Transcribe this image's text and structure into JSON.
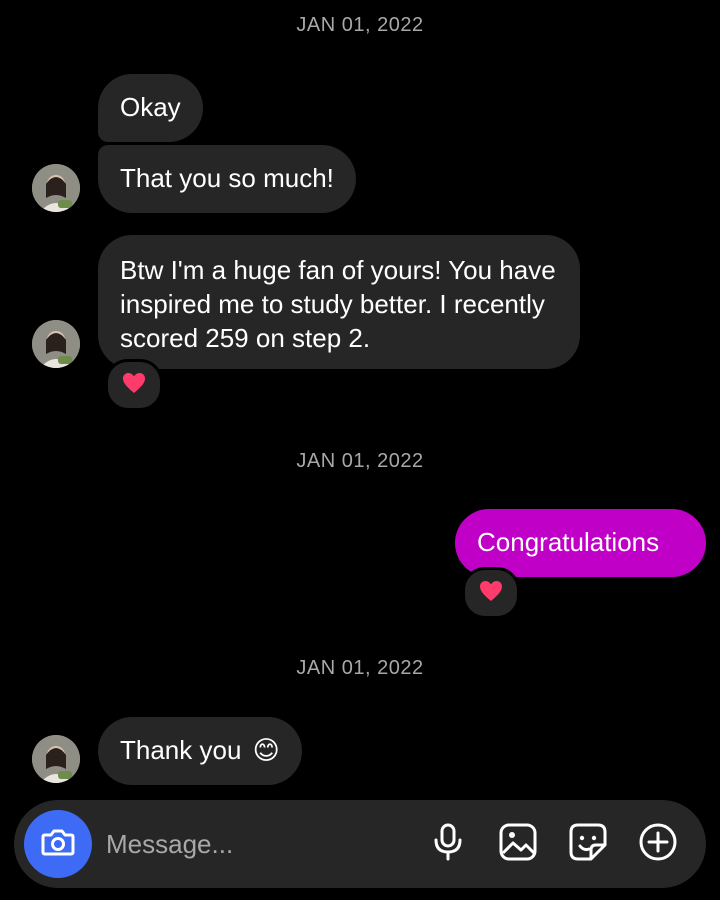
{
  "thread": {
    "date_1": "JAN 01, 2022",
    "date_2": "JAN 01, 2022",
    "date_3": "JAN 01, 2022",
    "messages": [
      {
        "from": "them",
        "text": "Okay"
      },
      {
        "from": "them",
        "text": "That you so much!"
      },
      {
        "from": "them",
        "text": "Btw I'm a huge fan of yours! You have inspired me to study better. I recently scored 259 on step 2.",
        "reaction": "heart"
      },
      {
        "from": "me",
        "text": "Congratulations",
        "reaction": "heart"
      },
      {
        "from": "them",
        "text": "Thank you",
        "emoji": "😊"
      }
    ]
  },
  "composer": {
    "placeholder": "Message...",
    "icons": [
      "camera-icon",
      "microphone-icon",
      "image-icon",
      "sticker-icon",
      "plus-icon"
    ]
  },
  "colors": {
    "background": "#000000",
    "incoming_bubble": "#262626",
    "outgoing_bubble": "#c100c7",
    "camera_button": "#3d6bf5",
    "date_text": "#a8a8a8",
    "reaction_heart": "#ff3b6b"
  }
}
